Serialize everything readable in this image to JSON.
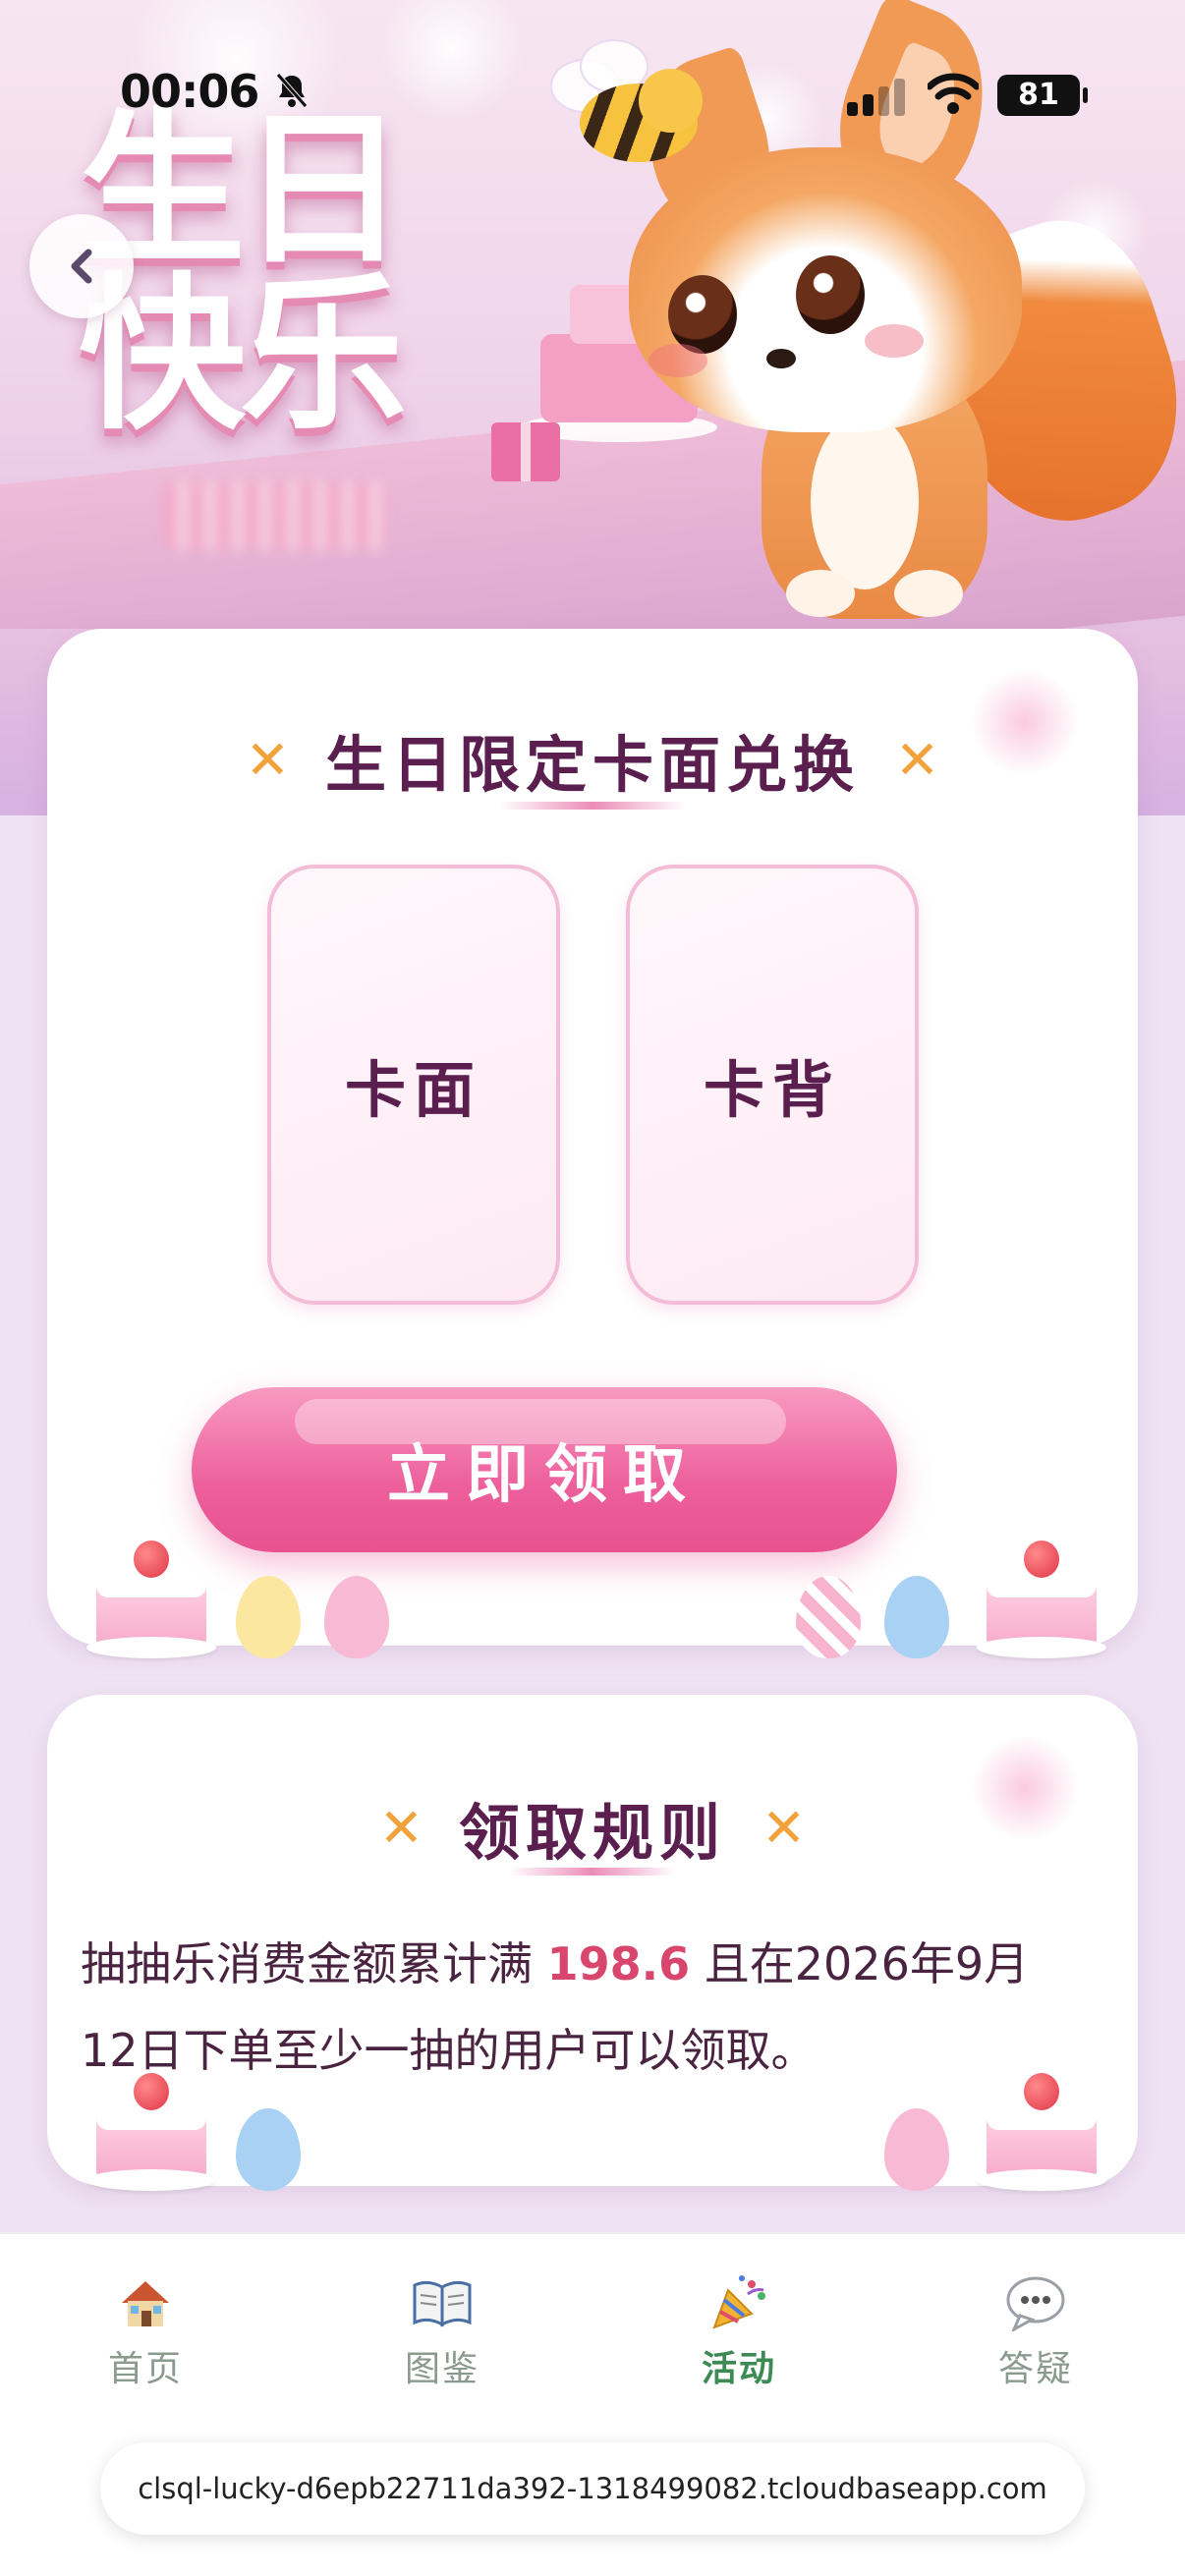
{
  "status_bar": {
    "time": "00:06",
    "battery": "81"
  },
  "hero": {
    "title_line1": "生日",
    "title_line2": "快乐"
  },
  "exchange_card": {
    "title": "生日限定卡面兑换",
    "tiles": [
      {
        "label": "卡面"
      },
      {
        "label": "卡背"
      }
    ],
    "claim_button": "立即领取"
  },
  "rules_card": {
    "title": "领取规则",
    "text_before": "抽抽乐消费金额累计满 ",
    "amount": "198.6",
    "text_after": " 且在2026年9月12日下单至少一抽的用户可以领取。"
  },
  "tab_bar": {
    "tabs": [
      {
        "label": "首页",
        "icon": "house-icon",
        "active": false
      },
      {
        "label": "图鉴",
        "icon": "open-book-icon",
        "active": false
      },
      {
        "label": "活动",
        "icon": "party-popper-icon",
        "active": true
      },
      {
        "label": "答疑",
        "icon": "speech-bubble-icon",
        "active": false
      }
    ]
  },
  "browser": {
    "url": "clsql-lucky-d6epb22711da392-1318499082.tcloudbaseapp.com"
  },
  "colors": {
    "accent_pink": "#ec5f9c",
    "title_purple": "#5a1f4f",
    "highlight_red": "#d8466d",
    "active_tab_green": "#3e8a55"
  }
}
